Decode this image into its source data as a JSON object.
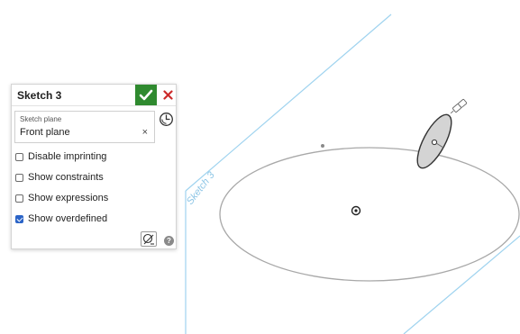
{
  "panel": {
    "title": "Sketch 3",
    "accept_icon": "checkmark-icon",
    "cancel_icon": "close-icon",
    "sketch_plane_label": "Sketch plane",
    "sketch_plane_value": "Front plane",
    "clear_symbol": "×",
    "view_icon": "view-normal-icon",
    "options": [
      {
        "label": "Disable imprinting",
        "checked": false
      },
      {
        "label": "Show constraints",
        "checked": false
      },
      {
        "label": "Show expressions",
        "checked": false
      },
      {
        "label": "Show overdefined",
        "checked": true
      }
    ],
    "sketch_tool_icon": "sketch-tool-icon",
    "help_symbol": "?"
  },
  "viewport": {
    "plane_label": "Sketch 3"
  },
  "colors": {
    "plane_edge": "#9fd3ef",
    "plane_label": "#8ec6e6",
    "accept_green": "#2f8a2f",
    "cancel_red": "#cc2b2b",
    "checkbox_blue": "#2b64c7",
    "curve_gray": "#a8a8a8"
  }
}
